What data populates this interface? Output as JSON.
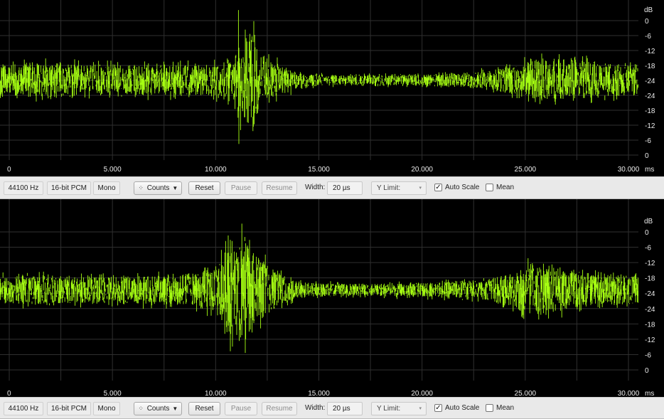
{
  "colors": {
    "waveform": "#a6ff12",
    "background": "#000000",
    "grid": "#2f2f2f",
    "toolbar": "#e9e9e9"
  },
  "panels": [
    {
      "y_unit": "dB",
      "y_ticks": [
        "0",
        "-6",
        "-12",
        "-18",
        "-24",
        "-24",
        "-18",
        "-12",
        "-6",
        "0"
      ],
      "x_ticks": [
        "0",
        "5.000",
        "10.000",
        "15.000",
        "20.000",
        "25.000",
        "30.000"
      ],
      "x_unit": "ms",
      "toolbar": {
        "sample_rate": "44100 Hz",
        "bit_depth": "16-bit PCM",
        "channels": "Mono",
        "mode": "Counts",
        "mode_icon": "scatter-dots-icon",
        "reset": "Reset",
        "pause": "Pause",
        "resume": "Resume",
        "width_label": "Width:",
        "width_value": "20 µs",
        "ylimit_placeholder": "Y Limit:",
        "auto_scale": "Auto Scale",
        "auto_scale_checked": true,
        "mean": "Mean",
        "mean_checked": false
      }
    },
    {
      "y_unit": "dB",
      "y_ticks": [
        "0",
        "-6",
        "-12",
        "-18",
        "-24",
        "-24",
        "-18",
        "-12",
        "-6",
        "0"
      ],
      "x_ticks": [
        "0",
        "5.000",
        "10.000",
        "15.000",
        "20.000",
        "25.000",
        "30.000"
      ],
      "x_unit": "ms",
      "toolbar": {
        "sample_rate": "44100 Hz",
        "bit_depth": "16-bit PCM",
        "channels": "Mono",
        "mode": "Counts",
        "mode_icon": "scatter-dots-icon",
        "reset": "Reset",
        "pause": "Pause",
        "resume": "Resume",
        "width_label": "Width:",
        "width_value": "20 µs",
        "ylimit_placeholder": "Y Limit:",
        "auto_scale": "Auto Scale",
        "auto_scale_checked": true,
        "mean": "Mean",
        "mean_checked": false
      }
    }
  ],
  "chart_data": [
    {
      "type": "area",
      "xlabel": "",
      "ylabel": "",
      "x_unit": "ms",
      "y_unit": "dB",
      "xlim": [
        0,
        30500
      ],
      "grid": true,
      "envelope": {
        "x": [
          0,
          1000,
          2000,
          4000,
          6000,
          8000,
          9500,
          10300,
          10900,
          11100,
          11300,
          11600,
          11800,
          12200,
          12800,
          13400,
          14000,
          15000,
          16000,
          18000,
          20000,
          22000,
          23500,
          24500,
          25500,
          26500,
          27500,
          28500,
          29500,
          30500
        ],
        "amplitude": [
          0.28,
          0.32,
          0.3,
          0.29,
          0.28,
          0.27,
          0.28,
          0.32,
          0.45,
          0.95,
          0.6,
          0.85,
          0.98,
          0.45,
          0.35,
          0.25,
          0.13,
          0.1,
          0.09,
          0.1,
          0.11,
          0.13,
          0.18,
          0.28,
          0.42,
          0.4,
          0.36,
          0.34,
          0.3,
          0.28
        ]
      }
    },
    {
      "type": "area",
      "xlabel": "",
      "ylabel": "",
      "x_unit": "ms",
      "y_unit": "dB",
      "xlim": [
        0,
        30500
      ],
      "grid": true,
      "envelope": {
        "x": [
          0,
          1000,
          2000,
          4000,
          6000,
          8000,
          9000,
          9800,
          10200,
          10600,
          11000,
          11200,
          11600,
          12000,
          12600,
          13200,
          14000,
          15000,
          17000,
          19000,
          21000,
          23000,
          24200,
          25000,
          26000,
          27000,
          28000,
          29000,
          30500
        ],
        "amplitude": [
          0.22,
          0.24,
          0.22,
          0.21,
          0.22,
          0.24,
          0.28,
          0.36,
          0.45,
          0.88,
          0.7,
          0.95,
          0.68,
          0.55,
          0.4,
          0.25,
          0.13,
          0.11,
          0.1,
          0.11,
          0.13,
          0.17,
          0.25,
          0.38,
          0.42,
          0.3,
          0.28,
          0.26,
          0.24
        ]
      }
    }
  ]
}
